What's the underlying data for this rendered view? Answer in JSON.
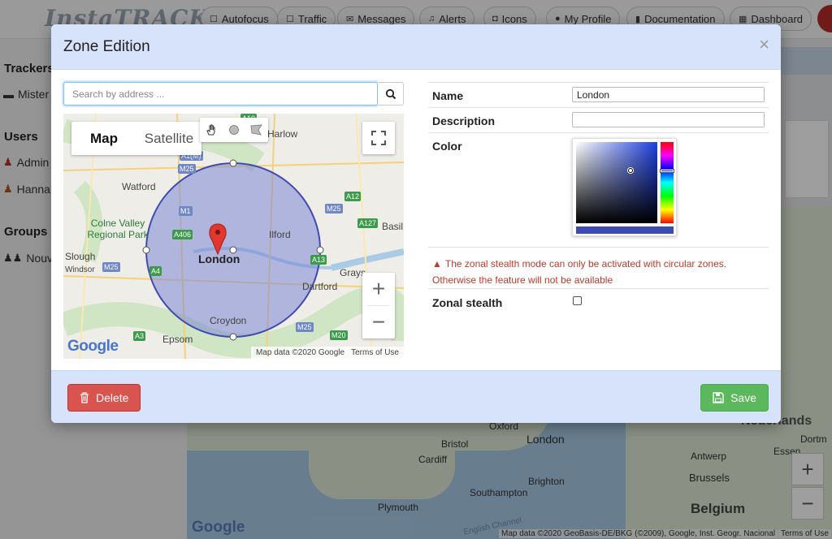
{
  "app": {
    "logo_text": "InstaTRACK",
    "nav": [
      {
        "label": "Autofocus",
        "icon": "checkbox-icon"
      },
      {
        "label": "Traffic",
        "icon": "checkbox-icon"
      },
      {
        "label": "Messages",
        "icon": "envelope-icon"
      },
      {
        "label": "Alerts",
        "icon": "bell-icon"
      },
      {
        "label": "Icons",
        "icon": "camera-icon"
      },
      {
        "label": "My Profile",
        "icon": "user-icon"
      },
      {
        "label": "Documentation",
        "icon": "book-icon"
      },
      {
        "label": "Dashboard",
        "icon": "table-icon"
      }
    ],
    "sidebar": {
      "trackers_heading": "Trackers",
      "tracker_item": "Mister",
      "users_heading": "Users",
      "users": [
        "Admin",
        "Hanna"
      ],
      "groups_heading": "Groups",
      "group_item": "Nouve"
    },
    "background_map": {
      "labels": [
        "Oxford",
        "London",
        "Bristol",
        "Cardiff",
        "Brighton",
        "Southampton",
        "Plymouth",
        "Nederlands",
        "Dortm",
        "Antwerp",
        "Essen",
        "Brussels",
        "Belgium",
        "English Channel"
      ],
      "google_logo": "Google",
      "attribution": "Map data ©2020 GeoBasis-DE/BKG (©2009), Google, Inst. Geogr. Nacional",
      "terms": "Terms of Use"
    }
  },
  "modal": {
    "title": "Zone Edition",
    "close_symbol": "×",
    "search": {
      "placeholder": "Search by address ...",
      "value": ""
    },
    "map": {
      "type_buttons": [
        "Map",
        "Satellite"
      ],
      "selected_type": "Map",
      "draw_tools": [
        "hand-icon",
        "circle-icon",
        "polygon-icon"
      ],
      "place_labels": [
        "Harlow",
        "Watford",
        "Colne Valley Regional Park",
        "Ilford",
        "Basil",
        "Slough",
        "Windsor",
        "London",
        "Grays",
        "Dartford",
        "Croydon",
        "Epsom"
      ],
      "road_labels": [
        "A10",
        "A1(M)",
        "M25",
        "M1",
        "A12",
        "A127",
        "A406",
        "M25",
        "A13",
        "A4",
        "M25",
        "A3",
        "M25",
        "M20"
      ],
      "google_logo": "Google",
      "attribution": "Map data ©2020 Google",
      "terms": "Terms of Use",
      "zoom_in": "+",
      "zoom_out": "−"
    },
    "form": {
      "name_label": "Name",
      "name_value": "London",
      "description_label": "Description",
      "description_value": "",
      "color_label": "Color",
      "color_value": "#3b4bb2",
      "warning_line1": "The zonal stealth mode can only be activated with circular zones.",
      "warning_line2": "Otherwise the feature will not be available",
      "stealth_label": "Zonal stealth",
      "stealth_checked": false
    },
    "delete_label": "Delete",
    "save_label": "Save"
  },
  "colors": {
    "zone_fill": "#7b86d4",
    "zone_stroke": "#3f4bb0",
    "save": "#5cb85c",
    "delete": "#d9534f",
    "warning": "#c0392b",
    "header_bg": "#d6e3fa"
  }
}
